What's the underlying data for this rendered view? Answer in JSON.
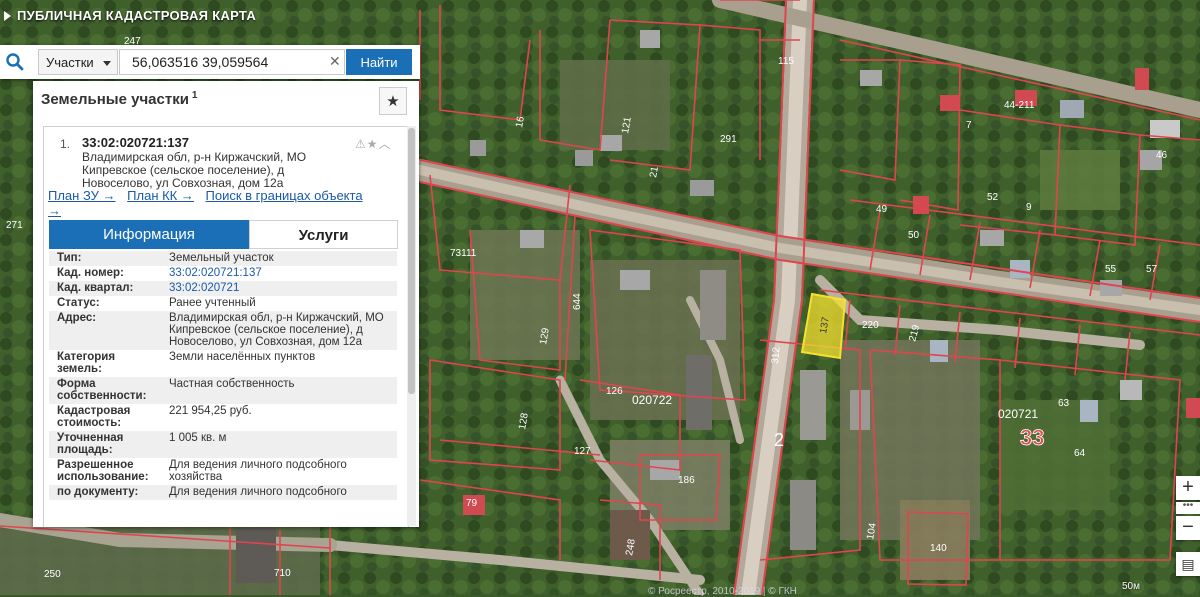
{
  "app": {
    "title": "ПУБЛИЧНАЯ КАДАСТРОВАЯ КАРТА"
  },
  "search": {
    "type_label": "Участки",
    "query": "56,063516 39,059564",
    "find_label": "Найти"
  },
  "panel": {
    "title": "Земельные участки",
    "title_count": "1",
    "item": {
      "index": "1.",
      "cad_number": "33:02:020721:137",
      "address": "Владимирская обл, р-н Киржачский, МО Кипревское (сельское поселение), д Новоселово, ул Совхозная, дом 12а",
      "links": [
        "План ЗУ →",
        "План КК →",
        "Поиск в границах объекта →"
      ]
    },
    "tabs": [
      "Информация",
      "Услуги"
    ],
    "rows": [
      {
        "key": "Тип:",
        "value": "Земельный участок"
      },
      {
        "key": "Кад. номер:",
        "value": "33:02:020721:137"
      },
      {
        "key": "Кад. квартал:",
        "value": "33:02:020721"
      },
      {
        "key": "Статус:",
        "value": "Ранее учтенный"
      },
      {
        "key": "Адрес:",
        "value": "Владимирская обл, р-н Киржачский, МО Кипревское (сельское поселение), д Новоселово, ул Совхозная, дом 12а"
      },
      {
        "key": "Категория земель:",
        "value": "Земли населённых пунктов"
      },
      {
        "key": "Форма собственности:",
        "value": "Частная собственность"
      },
      {
        "key": "Кадастровая стоимость:",
        "value": "221 954,25 руб."
      },
      {
        "key": "Уточненная площадь:",
        "value": "1 005 кв. м"
      },
      {
        "key": "Разрешенное использование:",
        "value": "Для ведения личного подсобного хозяйства"
      },
      {
        "key": "по документу:",
        "value": "Для ведения личного подсобного"
      }
    ]
  },
  "map": {
    "labels": {
      "l247": "247",
      "l271": "271",
      "l291": "291",
      "l115": "115",
      "l44": "44-211",
      "l46": "46",
      "l7": "7",
      "l9": "9",
      "l52": "52",
      "l49": "49",
      "l50": "50",
      "l55": "55",
      "l57": "57",
      "l73": "73111",
      "l644": "644",
      "l129": "129",
      "l126": "126",
      "l127": "127",
      "l128": "128",
      "l186": "186",
      "l220": "220",
      "l219": "219",
      "l312": "312",
      "l137": "137",
      "l2": "2",
      "l33": "33",
      "q020722": "020722",
      "q020721": "020721",
      "l63": "63",
      "l64": "64",
      "l140": "140",
      "l104": "104",
      "l248": "248",
      "l710": "710",
      "l250": "250",
      "l79": "79",
      "l21": "21",
      "l16": "16",
      "l121": "121"
    },
    "scale": "50м",
    "copyright": "© Росреестр, 2010-2019 | © ГКН"
  },
  "zoom": {
    "in": "+",
    "out": "−",
    "mid": "•••"
  },
  "colors": {
    "accent": "#1a6fb7",
    "boundary": "#e0454f",
    "selected": "#f5e030"
  }
}
